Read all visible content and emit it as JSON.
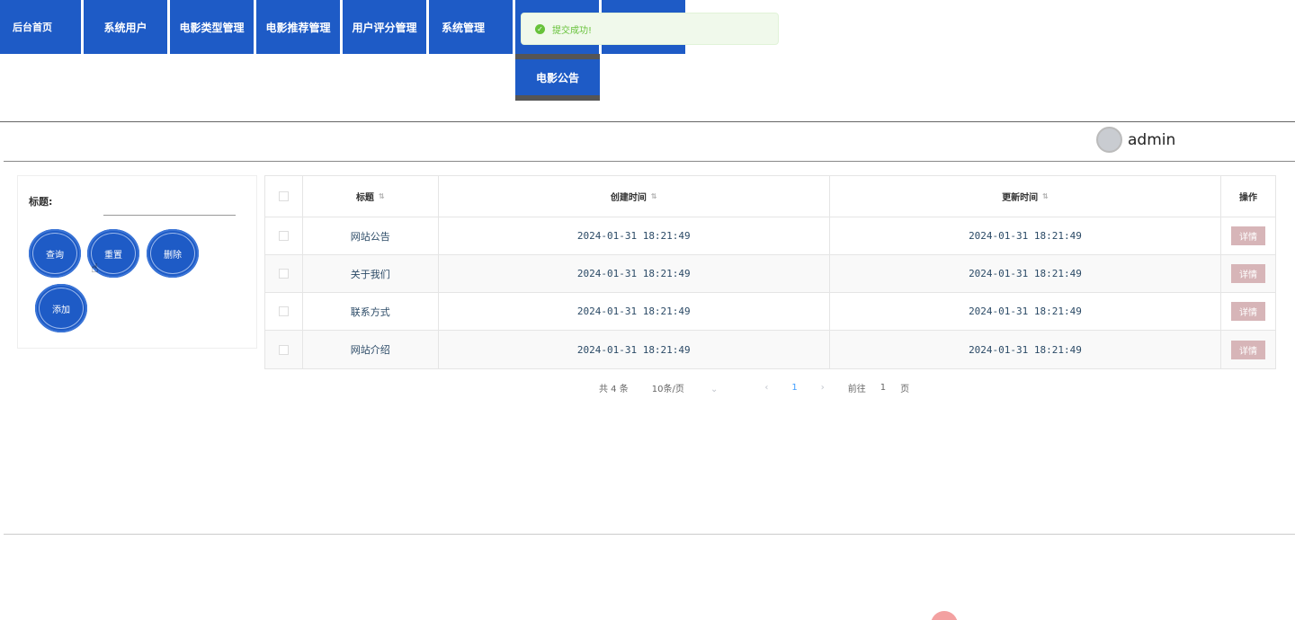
{
  "nav": {
    "items": [
      {
        "label": "后台首页"
      },
      {
        "label": "系统用户"
      },
      {
        "label": "电影类型管理"
      },
      {
        "label": "电影推荐管理"
      },
      {
        "label": "用户评分管理"
      },
      {
        "label": "系统管理"
      }
    ],
    "submenu_label": "电影公告"
  },
  "toast": {
    "message": "提交成功!",
    "icon": "success-check-icon"
  },
  "user": {
    "name": "admin"
  },
  "search": {
    "label": "标题:",
    "value": "",
    "buttons": {
      "query": "查询",
      "reset": "重置",
      "delete": "删除",
      "add": "添加"
    }
  },
  "table": {
    "headers": {
      "title": "标题",
      "created": "创建时间",
      "updated": "更新时间",
      "actions": "操作"
    },
    "rows": [
      {
        "title": "网站公告",
        "created": "2024-01-31 18:21:49",
        "updated": "2024-01-31 18:21:49",
        "action": "详情"
      },
      {
        "title": "关于我们",
        "created": "2024-01-31 18:21:49",
        "updated": "2024-01-31 18:21:49",
        "action": "详情"
      },
      {
        "title": "联系方式",
        "created": "2024-01-31 18:21:49",
        "updated": "2024-01-31 18:21:49",
        "action": "详情"
      },
      {
        "title": "网站介绍",
        "created": "2024-01-31 18:21:49",
        "updated": "2024-01-31 18:21:49",
        "action": "详情"
      }
    ]
  },
  "pagination": {
    "total": "共 4 条",
    "page_size": "10条/页",
    "current_page": "1",
    "goto_prefix": "前往",
    "goto_value": "1",
    "goto_suffix": "页"
  },
  "colors": {
    "primary": "#1e5bc6",
    "success": "#67c23a",
    "detail_button": "#d7b5b8"
  }
}
